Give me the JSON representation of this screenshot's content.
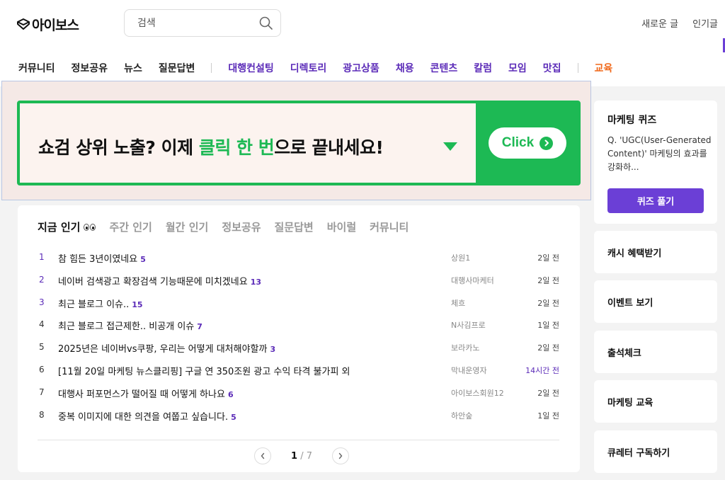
{
  "header": {
    "logo_text": "아이보스",
    "search": {
      "placeholder": "검색",
      "value": ""
    },
    "top_links": [
      "새로운 글",
      "인기글"
    ]
  },
  "nav": {
    "community": [
      "커뮤니티",
      "정보공유",
      "뉴스",
      "질문답변"
    ],
    "services": [
      "대행컨설팅",
      "디렉토리",
      "광고상품",
      "채용",
      "콘텐츠",
      "칼럼",
      "모임",
      "맛집"
    ],
    "education": "교육"
  },
  "banner": {
    "text_before": "쇼검 상위 노출? 이제 ",
    "text_highlight": "클릭 한 번",
    "text_after": "으로 끝내세요!",
    "button_label": "Click",
    "accent": "#1db954"
  },
  "popular": {
    "tabs": [
      "지금 인기",
      "주간 인기",
      "월간 인기",
      "정보공유",
      "질문답변",
      "바이럴",
      "커뮤니티"
    ],
    "posts": [
      {
        "rank": "1",
        "title": "참 힘든 3년이였네요",
        "comments": "5",
        "author": "상원1",
        "time": "2일 전"
      },
      {
        "rank": "2",
        "title": "네이버 검색광고 확장검색 기능때문에 미치겠네요",
        "comments": "13",
        "author": "대행사마케터",
        "time": "2일 전"
      },
      {
        "rank": "3",
        "title": "최근 블로그 이슈..",
        "comments": "15",
        "author": "체흐",
        "time": "2일 전"
      },
      {
        "rank": "4",
        "title": "최근 블로그 접근제한.. 비공개 이슈",
        "comments": "7",
        "author": "N사김프로",
        "time": "1일 전"
      },
      {
        "rank": "5",
        "title": "2025년은 네이버vs쿠팡, 우리는 어떻게 대처해야할까",
        "comments": "3",
        "author": "보라카노",
        "time": "2일 전"
      },
      {
        "rank": "6",
        "title": "[11월 20일 마케팅 뉴스클리핑] 구글 연 350조원 광고 수익 타격 불가피 외",
        "comments": "",
        "author": "막내운영자",
        "time": "14시간 전"
      },
      {
        "rank": "7",
        "title": "대행사 퍼포먼스가 떨어질 때 어떻게 하나요",
        "comments": "6",
        "author": "아이보스회원12",
        "time": "2일 전"
      },
      {
        "rank": "8",
        "title": "중복 이미지에 대한 의견을 여쭙고 싶습니다.",
        "comments": "5",
        "author": "하안숲",
        "time": "1일 전"
      }
    ],
    "pagination": {
      "current": "1",
      "total": "/ 7"
    }
  },
  "sidebar": {
    "quiz": {
      "title": "마케팅 퀴즈",
      "question": "Q. 'UGC(User-Generated Content)' 마케팅의 효과를 강화하...",
      "button": "퀴즈 풀기"
    },
    "cards": [
      "캐시 혜택받기",
      "이벤트 보기",
      "출석체크",
      "마케팅 교육",
      "큐레터 구독하기"
    ]
  },
  "colors": {
    "brand_purple": "#5b2bb8",
    "button_purple": "#6b3fd6",
    "education_orange": "#f06a1d",
    "banner_green": "#1db954"
  }
}
